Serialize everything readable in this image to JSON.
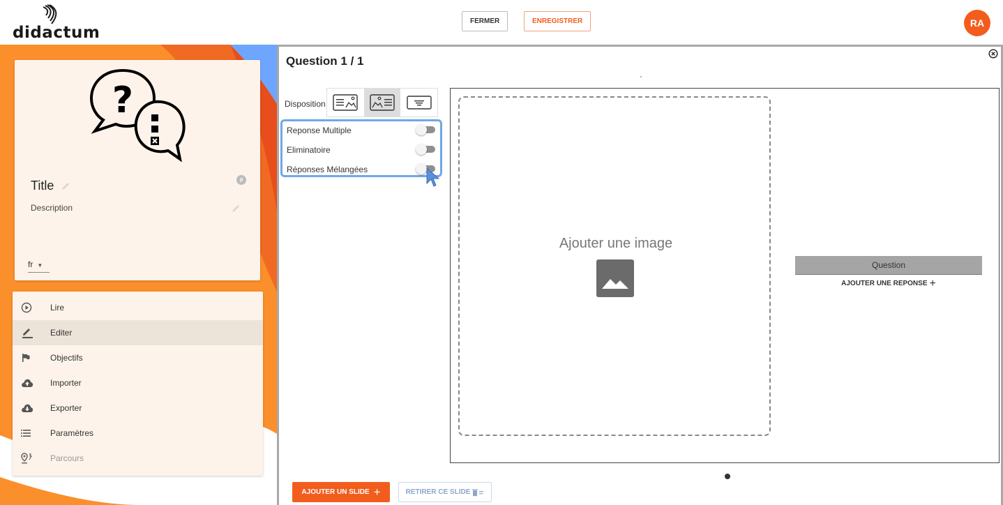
{
  "header": {
    "logo_text": "didactum",
    "close_label": "FERMER",
    "save_label": "ENREGISTRER",
    "avatar_initials": "RA"
  },
  "card": {
    "title": "Title",
    "description": "Description",
    "language": "fr"
  },
  "menu": {
    "items": [
      {
        "label": "Lire",
        "icon": "play-circle-icon"
      },
      {
        "label": "Editer",
        "icon": "pencil-icon"
      },
      {
        "label": "Objectifs",
        "icon": "flag-icon"
      },
      {
        "label": "Importer",
        "icon": "cloud-upload-icon"
      },
      {
        "label": "Exporter",
        "icon": "cloud-download-icon"
      },
      {
        "label": "Paramètres",
        "icon": "list-icon"
      },
      {
        "label": "Parcours",
        "icon": "route-icon"
      }
    ],
    "active": "Editer"
  },
  "editor": {
    "title": "Question 1 / 1",
    "disposition_label": "Disposition",
    "options": [
      {
        "label": "Reponse Multiple",
        "on": false
      },
      {
        "label": "Eliminatoire",
        "on": false
      },
      {
        "label": "Réponses Mélangées",
        "on": false
      }
    ],
    "add_image_label": "Ajouter une image",
    "question_label": "Question",
    "add_response_label": "AJOUTER UNE REPONSE",
    "add_slide_label": "AJOUTER UN SLIDE",
    "remove_slide_label": "RETIRER CE SLIDE"
  },
  "colors": {
    "accent": "#f25d1e",
    "orange_bg": "#fb8f2b",
    "highlight_blue": "#6fa8e8"
  }
}
